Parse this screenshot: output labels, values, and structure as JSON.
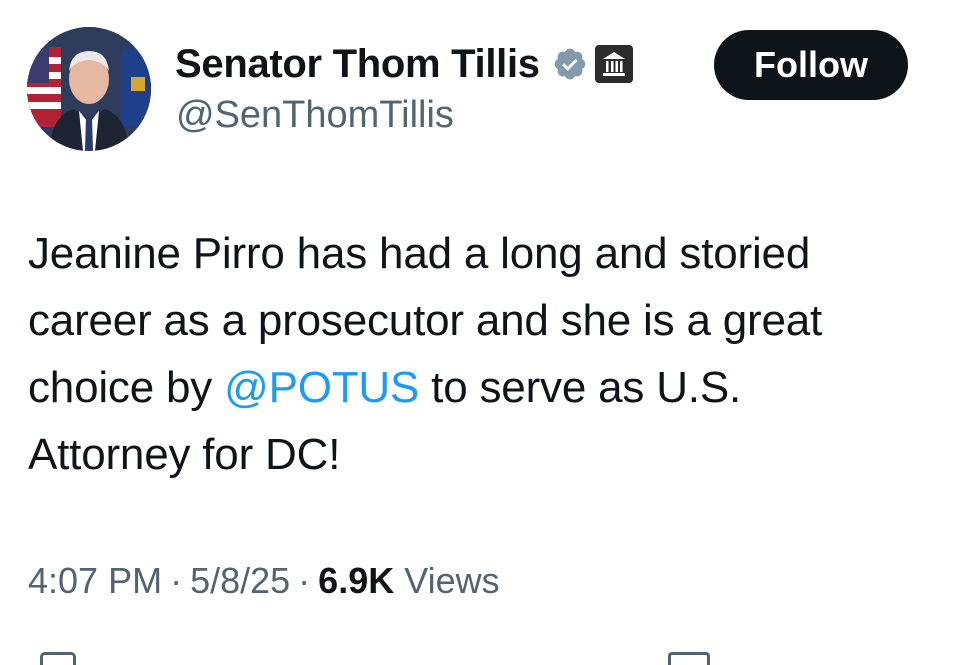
{
  "profile": {
    "display_name": "Senator Thom Tillis",
    "handle": "@SenThomTillis",
    "verified_icon": "verified-badge-icon",
    "affiliation_icon": "government-building-icon"
  },
  "follow_button": {
    "label": "Follow"
  },
  "tweet": {
    "line1": "Jeanine Pirro has had a long and storied",
    "line2": "career as a prosecutor and she is a great",
    "line3_before": "choice by ",
    "mention": "@POTUS",
    "line3_after": " to serve as U.S.",
    "line4": "Attorney for DC!"
  },
  "meta": {
    "time": "4:07 PM",
    "separator": "·",
    "date": "5/8/25",
    "views_count": "6.9K",
    "views_label": "Views"
  },
  "colors": {
    "text": "#0f1419",
    "secondary": "#536471",
    "link": "#1d9bf0",
    "verified": "#829aab",
    "button": "#0f1419"
  }
}
